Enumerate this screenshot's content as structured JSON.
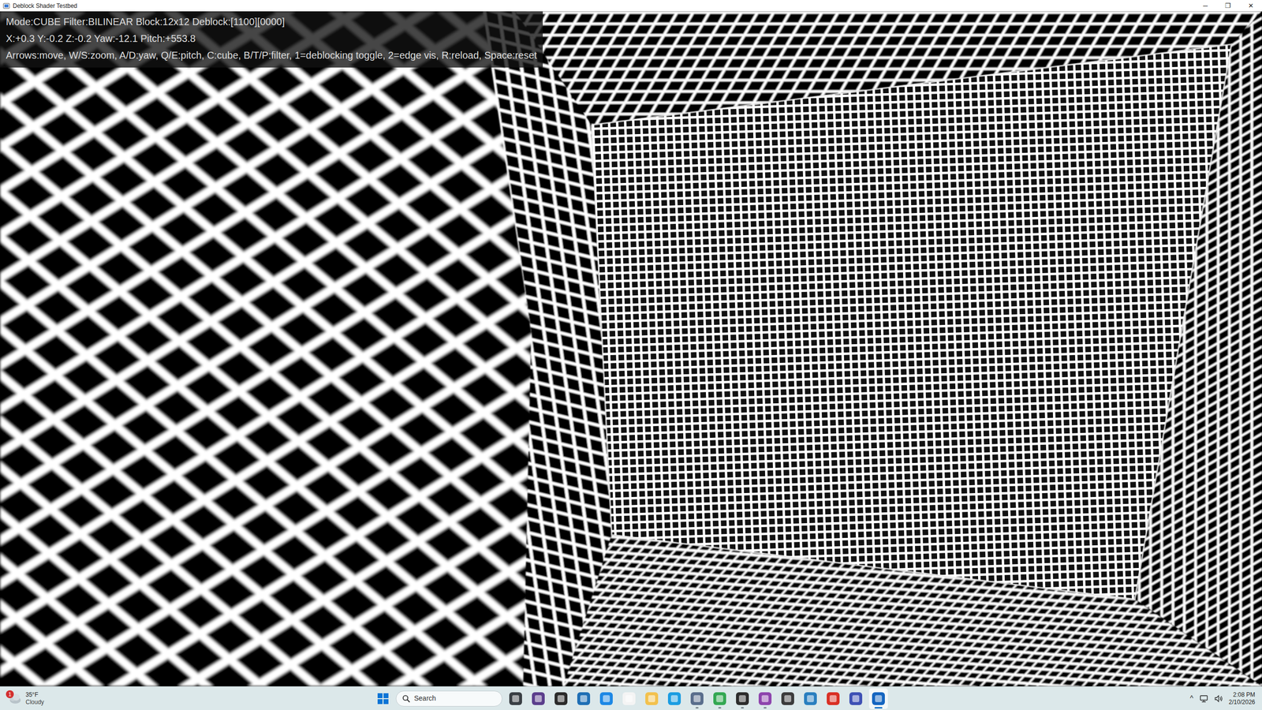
{
  "window": {
    "title": "Deblock Shader Testbed",
    "controls": [
      "─",
      "❐",
      "✕"
    ]
  },
  "overlay": {
    "lines": [
      "Mode:CUBE Filter:BILINEAR Block:12x12 Deblock:[1100][0000]",
      "X:+0.3 Y:-0.2 Z:-0.2 Yaw:-12.1 Pitch:+553.8",
      "Arrows:move, W/S:zoom, A/D:yaw, Q/E:pitch, C:cube, B/T/P:filter, 1=deblocking toggle, 2=edge vis, R:reload, Space:reset"
    ]
  },
  "taskbar": {
    "weather": {
      "temperature": "35°F",
      "condition": "Cloudy",
      "badge": "1"
    },
    "search": {
      "placeholder": "Search"
    },
    "apps": [
      {
        "color": "#3a3f44",
        "running": false,
        "selected": false
      },
      {
        "color": "#5b3e8c",
        "running": false,
        "selected": false
      },
      {
        "color": "#2b2b2b",
        "running": false,
        "selected": false
      },
      {
        "color": "#1f6fb5",
        "running": false,
        "selected": false
      },
      {
        "color": "#1e88e5",
        "running": false,
        "selected": false
      },
      {
        "color": "#f4f4f4",
        "running": false,
        "selected": false
      },
      {
        "color": "#f2c14e",
        "running": false,
        "selected": false
      },
      {
        "color": "#1b9de2",
        "running": false,
        "selected": false
      },
      {
        "color": "#5a6e8c",
        "running": true,
        "selected": false
      },
      {
        "color": "#34a853",
        "running": true,
        "selected": false
      },
      {
        "color": "#2d2d2d",
        "running": true,
        "selected": false
      },
      {
        "color": "#8e44ad",
        "running": true,
        "selected": false
      },
      {
        "color": "#3c3c3c",
        "running": false,
        "selected": false
      },
      {
        "color": "#2a7fbf",
        "running": false,
        "selected": false
      },
      {
        "color": "#d93025",
        "running": false,
        "selected": false
      },
      {
        "color": "#3f51b5",
        "running": false,
        "selected": false
      },
      {
        "color": "#1565c0",
        "running": true,
        "selected": true
      }
    ],
    "tray": {
      "chevron": "^",
      "time": "2:08 PM",
      "date": "2/10/2026"
    }
  }
}
